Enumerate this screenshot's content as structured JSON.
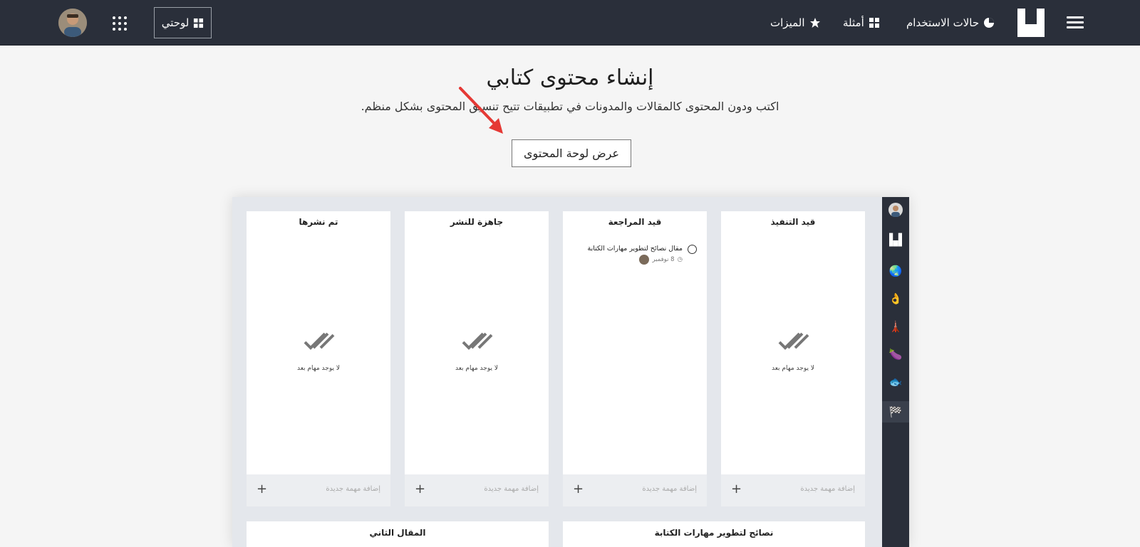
{
  "nav": {
    "use_cases": "حالات الاستخدام",
    "examples": "أمثلة",
    "features": "الميزات",
    "my_board": "لوحتي"
  },
  "hero": {
    "title": "إنشاء محتوى كتابي",
    "subtitle": "اكتب ودون المحتوى كالمقالات والمدونات في تطبيقات تتيح تنسيق المحتوى بشكل منظم.",
    "cta": "عرض لوحة المحتوى"
  },
  "board": {
    "columns": [
      {
        "title": "قيد التنفيذ",
        "empty": "لا يوجد مهام بعد",
        "add": "إضافة مهمة جديدة"
      },
      {
        "title": "قيد المراجعة",
        "add": "إضافة مهمة جديدة",
        "task": {
          "title": "مقال نصائح لتطوير مهارات الكتابة",
          "date": "8 نوفمبر"
        }
      },
      {
        "title": "جاهزة للنشر",
        "empty": "لا يوجد مهام بعد",
        "add": "إضافة مهمة جديدة"
      },
      {
        "title": "تم نشرها",
        "empty": "لا يوجد مهام بعد",
        "add": "إضافة مهمة جديدة"
      }
    ],
    "second_row": [
      {
        "title": "نصائح لتطوير مهارات الكتابة"
      },
      {
        "title": "المقال الثاني"
      }
    ],
    "sidebar_icons": [
      "avatar",
      "logo-icon",
      "globe-icon",
      "ok-hand-icon",
      "tower-icon",
      "eggplant-icon",
      "fish-icon",
      "checkered-flag-icon"
    ]
  },
  "colors": {
    "topbar": "#2a2f3a",
    "annotation_arrow": "#e53935"
  }
}
